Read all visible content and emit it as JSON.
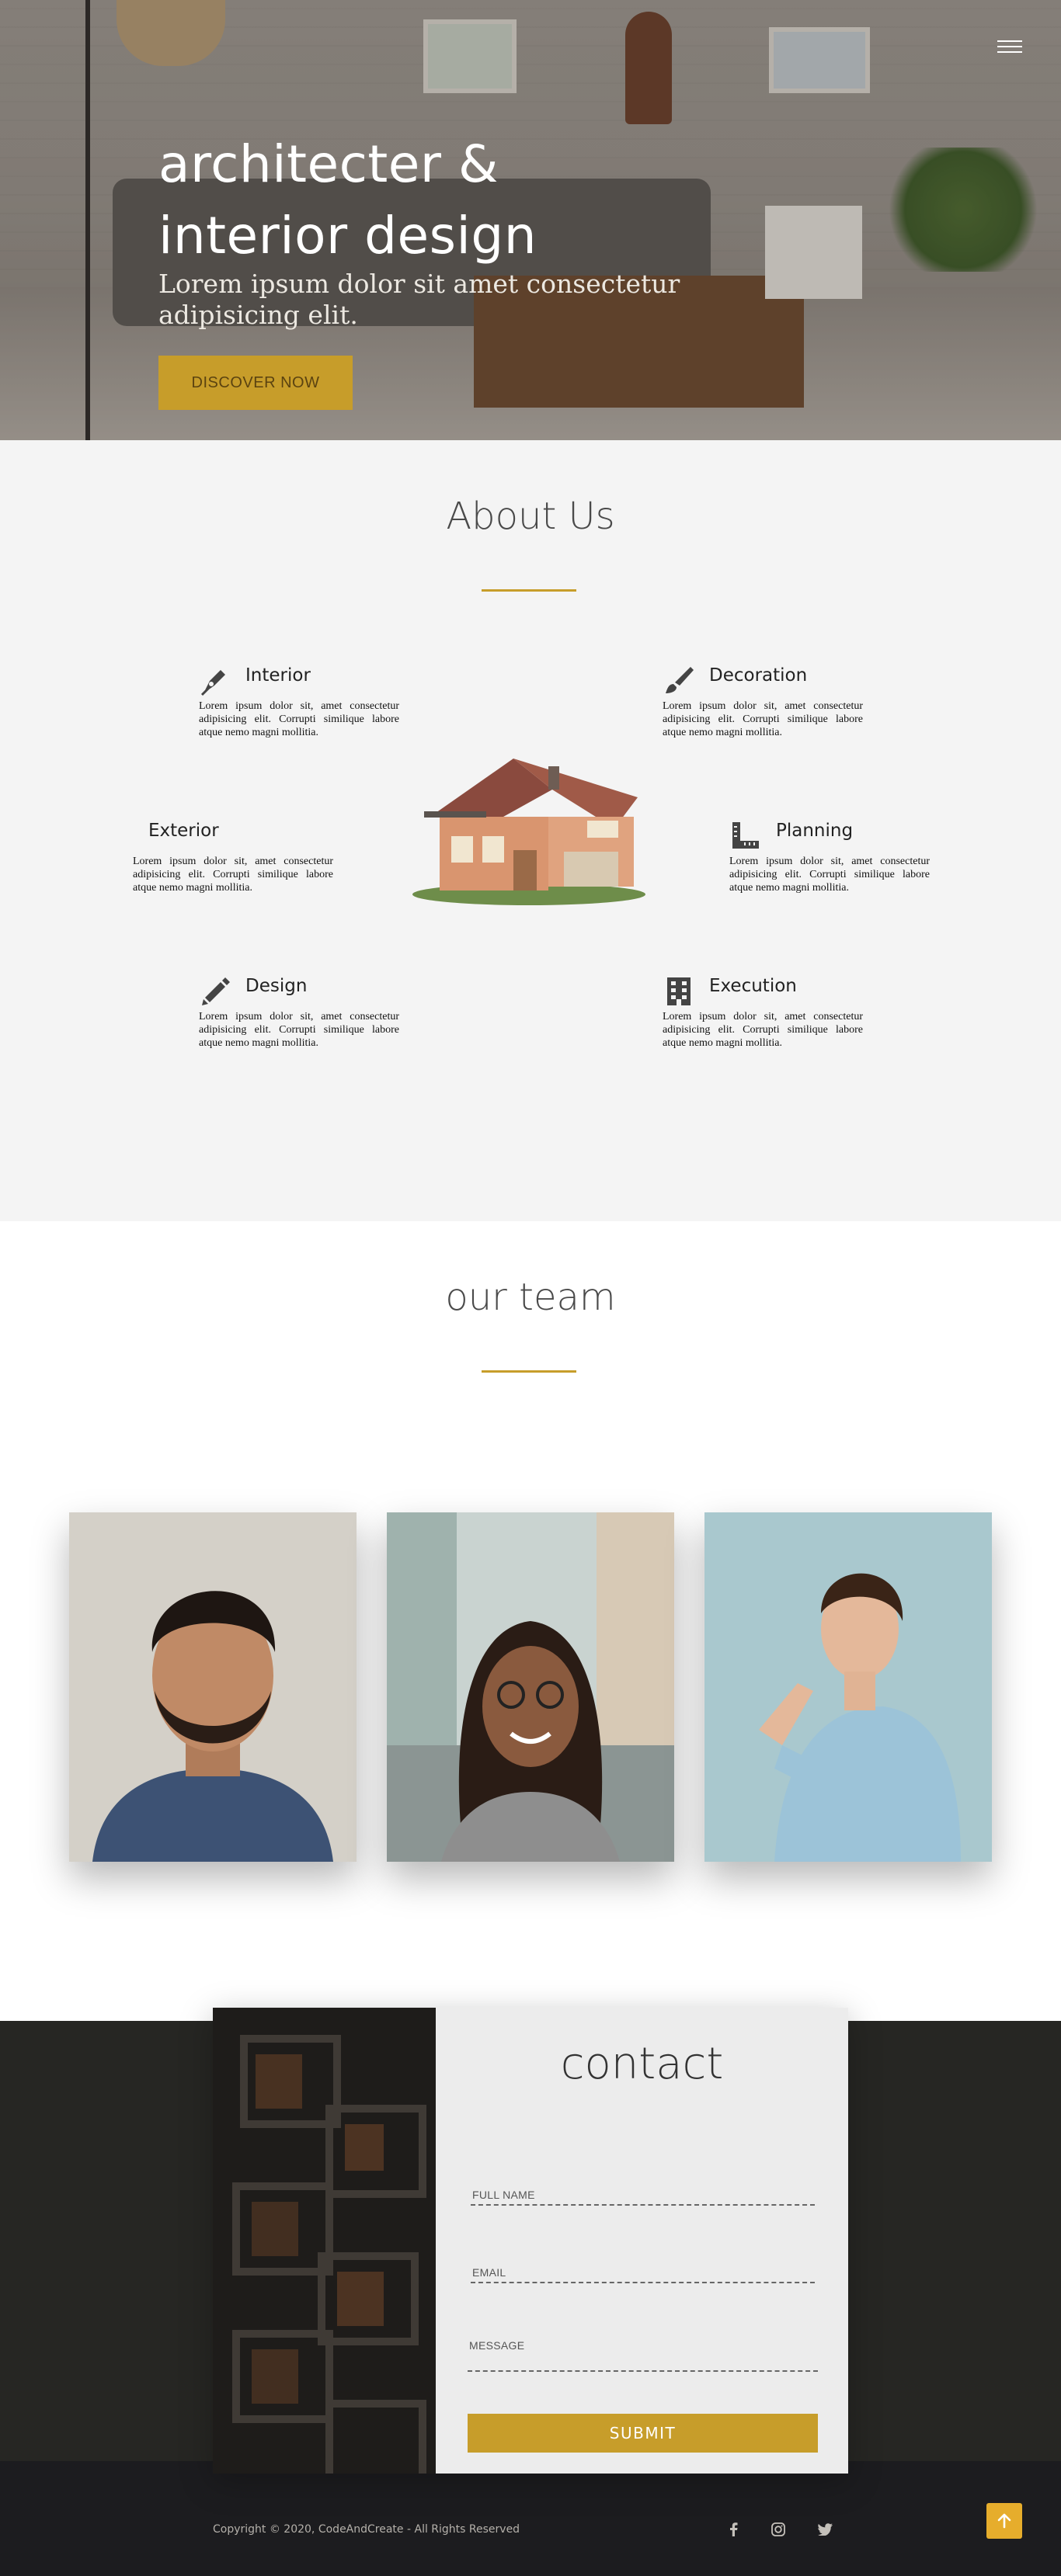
{
  "hero": {
    "title_line1": "architecter &",
    "title_line2": "interior design",
    "subtitle_line1": "Lorem ipsum dolor sit amet consectetur",
    "subtitle_line2": "adipisicing elit.",
    "cta_label": "DISCOVER NOW",
    "menu_icon": "hamburger-menu-icon"
  },
  "about": {
    "title": "About Us",
    "features": [
      {
        "name": "Interior",
        "icon": "pen-nib-icon",
        "text": "Lorem ipsum dolor sit, amet consectetur adipisicing elit. Corrupti similique labore atque nemo magni mollitia."
      },
      {
        "name": "Decoration",
        "icon": "paint-brush-icon",
        "text": "Lorem ipsum dolor sit, amet consectetur adipisicing elit. Corrupti similique labore atque nemo magni mollitia."
      },
      {
        "name": "Exterior",
        "icon": "",
        "text": "Lorem ipsum dolor sit, amet consectetur adipisicing elit. Corrupti similique labore atque nemo magni mollitia."
      },
      {
        "name": "Planning",
        "icon": "ruler-combined-icon",
        "text": "Lorem ipsum dolor sit, amet consectetur adipisicing elit. Corrupti similique labore atque nemo magni mollitia."
      },
      {
        "name": "Design",
        "icon": "pencil-icon",
        "text": "Lorem ipsum dolor sit, amet consectetur adipisicing elit. Corrupti similique labore atque nemo magni mollitia."
      },
      {
        "name": "Execution",
        "icon": "building-icon",
        "text": "Lorem ipsum dolor sit, amet consectetur adipisicing elit. Corrupti similique labore atque nemo magni mollitia."
      }
    ]
  },
  "team": {
    "title": "our team"
  },
  "contact": {
    "title": "contact",
    "full_name_placeholder": "FULL NAME",
    "email_placeholder": "EMAIL",
    "message_placeholder": "MESSAGE",
    "submit_label": "SUBMIT"
  },
  "footer": {
    "copyright": "Copyright © 2020, CodeAndCreate - All Rights Reserved",
    "social": [
      "facebook-icon",
      "instagram-icon",
      "twitter-icon"
    ],
    "to_top_icon": "arrow-up-icon"
  },
  "colors": {
    "accent": "#c79d2a",
    "about_bg": "#f4f4f4",
    "dark_bg": "#262623",
    "footer_bg": "#1c1c1f"
  }
}
